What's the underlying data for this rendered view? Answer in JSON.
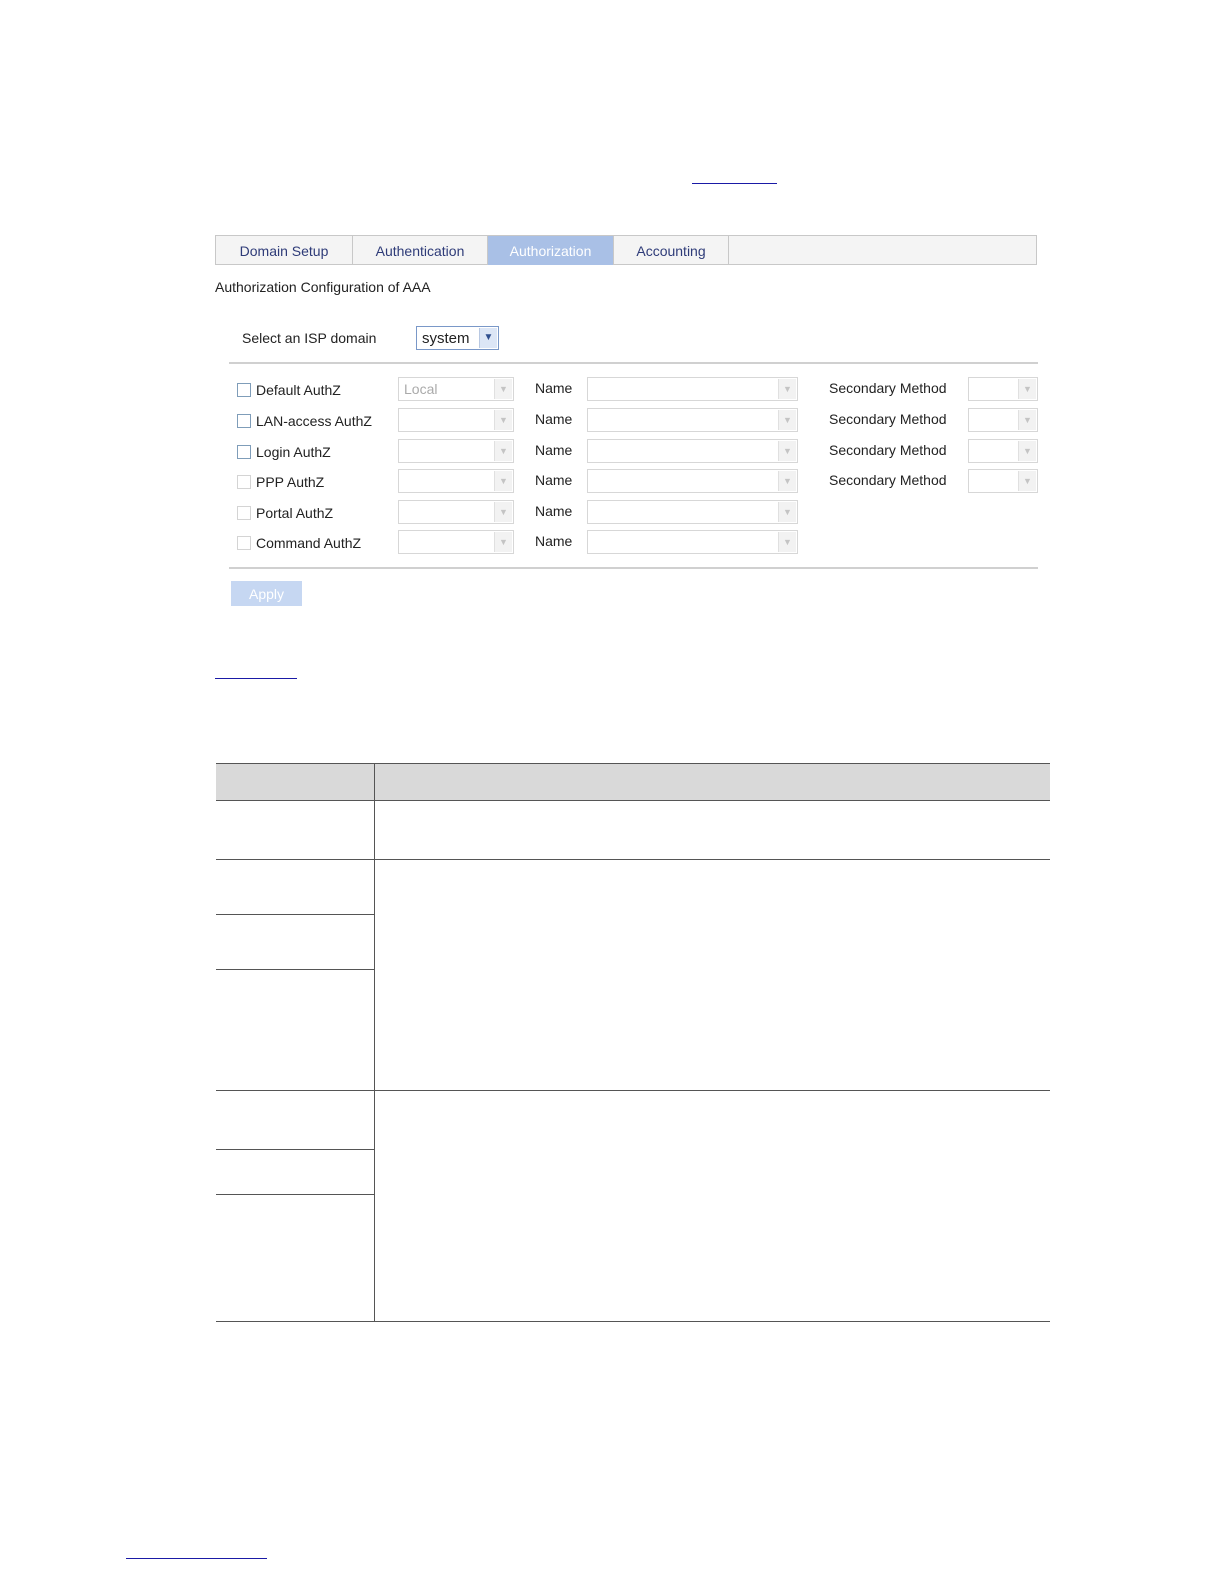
{
  "tabs": [
    {
      "label": "Domain Setup",
      "active": false
    },
    {
      "label": "Authentication",
      "active": false
    },
    {
      "label": "Authorization",
      "active": true
    },
    {
      "label": "Accounting",
      "active": false
    }
  ],
  "section_title": "Authorization Configuration of AAA",
  "isp": {
    "label": "Select an ISP domain",
    "value": "system"
  },
  "rows": [
    {
      "label": "Default AuthZ",
      "method": "Local",
      "name_label": "Name",
      "secondary_label": "Secondary Method",
      "checkbox_enabled": true
    },
    {
      "label": "LAN-access AuthZ",
      "method": "",
      "name_label": "Name",
      "secondary_label": "Secondary Method",
      "checkbox_enabled": true
    },
    {
      "label": "Login AuthZ",
      "method": "",
      "name_label": "Name",
      "secondary_label": "Secondary Method",
      "checkbox_enabled": true
    },
    {
      "label": "PPP AuthZ",
      "method": "",
      "name_label": "Name",
      "secondary_label": "Secondary Method",
      "checkbox_enabled": false
    },
    {
      "label": "Portal AuthZ",
      "method": "",
      "name_label": "Name",
      "secondary_label": "",
      "checkbox_enabled": false
    },
    {
      "label": "Command AuthZ",
      "method": "",
      "name_label": "Name",
      "secondary_label": "",
      "checkbox_enabled": false
    }
  ],
  "apply_label": "Apply",
  "colors": {
    "active_tab": "#a9c0e6",
    "tab_text": "#2e3b78",
    "apply_disabled": "#c6d7f2"
  }
}
